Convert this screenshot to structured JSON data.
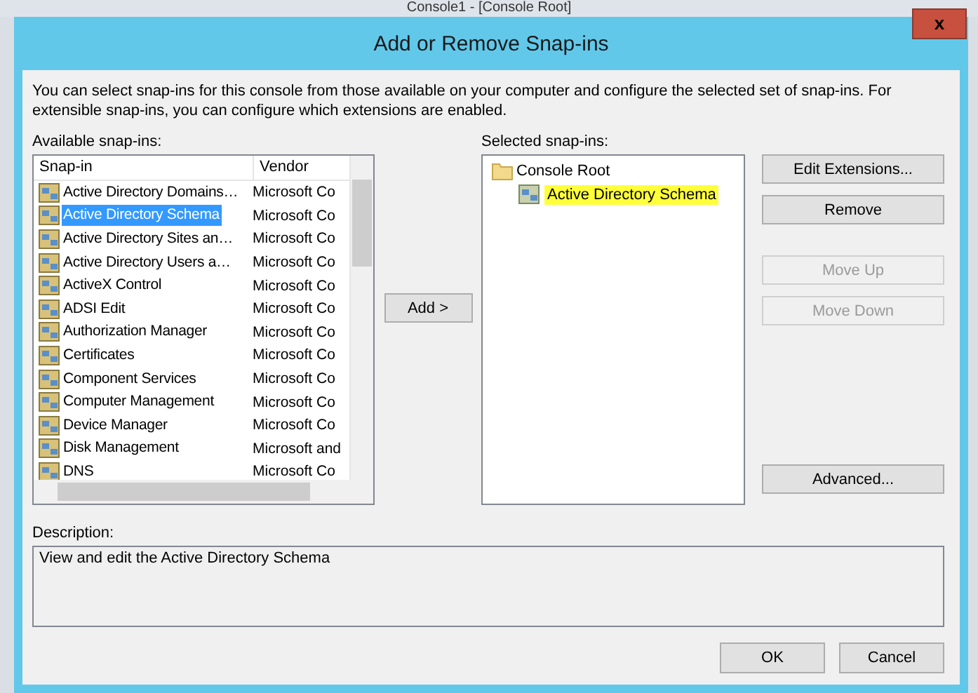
{
  "background_window": {
    "title": "Console1 - [Console Root]"
  },
  "window": {
    "title": "Add or Remove Snap-ins",
    "close": "x"
  },
  "intro": "You can select snap-ins for this console from those available on your computer and configure the selected set of snap-ins. For extensible snap-ins, you can configure which extensions are enabled.",
  "available": {
    "label": "Available snap-ins:",
    "columns": [
      "Snap-in",
      "Vendor"
    ],
    "rows": [
      {
        "name": "Active Directory Domains…",
        "vendor": "Microsoft Co",
        "selected": false
      },
      {
        "name": "Active Directory Schema",
        "vendor": "Microsoft Co",
        "selected": true
      },
      {
        "name": "Active Directory Sites an…",
        "vendor": "Microsoft Co",
        "selected": false
      },
      {
        "name": "Active Directory Users a…",
        "vendor": "Microsoft Co",
        "selected": false
      },
      {
        "name": "ActiveX Control",
        "vendor": "Microsoft Co",
        "selected": false
      },
      {
        "name": "ADSI Edit",
        "vendor": "Microsoft Co",
        "selected": false
      },
      {
        "name": "Authorization Manager",
        "vendor": "Microsoft Co",
        "selected": false
      },
      {
        "name": "Certificates",
        "vendor": "Microsoft Co",
        "selected": false
      },
      {
        "name": "Component Services",
        "vendor": "Microsoft Co",
        "selected": false
      },
      {
        "name": "Computer Management",
        "vendor": "Microsoft Co",
        "selected": false
      },
      {
        "name": "Device Manager",
        "vendor": "Microsoft Co",
        "selected": false
      },
      {
        "name": "Disk Management",
        "vendor": "Microsoft and",
        "selected": false
      },
      {
        "name": "DNS",
        "vendor": "Microsoft Co",
        "selected": false
      }
    ]
  },
  "add_button": "Add >",
  "selected": {
    "label": "Selected snap-ins:",
    "tree": {
      "label": "Console Root",
      "children": [
        {
          "label": "Active Directory Schema",
          "highlighted": true
        }
      ]
    }
  },
  "side_buttons": [
    {
      "label": "Edit Extensions...",
      "disabled": false
    },
    {
      "label": "Remove",
      "disabled": false
    },
    {
      "label": "Move Up",
      "disabled": true
    },
    {
      "label": "Move Down",
      "disabled": true
    }
  ],
  "advanced_button": "Advanced...",
  "description": {
    "label": "Description:",
    "text": "View and edit the Active Directory Schema"
  },
  "buttons": [
    "OK",
    "Cancel"
  ]
}
